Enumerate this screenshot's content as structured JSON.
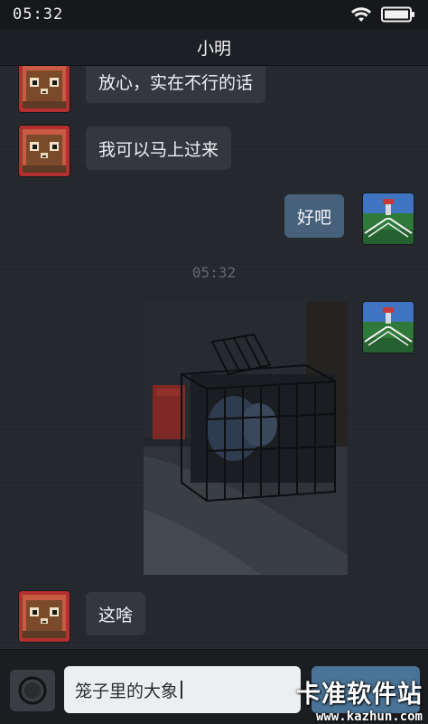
{
  "status_bar": {
    "time": "05:32",
    "wifi_icon": "wifi-icon",
    "battery_icon": "battery-icon"
  },
  "header": {
    "title": "小明"
  },
  "messages": [
    {
      "from": "contact",
      "text": "放心，实在不行的话"
    },
    {
      "from": "contact",
      "text": "我可以马上过来"
    },
    {
      "from": "me",
      "text": "好吧"
    },
    {
      "type": "timestamp",
      "text": "05:32"
    },
    {
      "from": "me",
      "type": "image",
      "description": "photo"
    },
    {
      "from": "contact",
      "text": "这啥"
    }
  ],
  "input": {
    "value": "笼子里的大象"
  },
  "send_button": {
    "label": ""
  },
  "icons": {
    "camera": "camera-icon"
  },
  "watermark": {
    "text": "卡准软件站",
    "url": "www.kazhun.com"
  },
  "colors": {
    "background": "#24272c",
    "incoming_bubble": "#34373d",
    "outgoing_bubble": "#47617a",
    "send_button": "#4a7497"
  }
}
